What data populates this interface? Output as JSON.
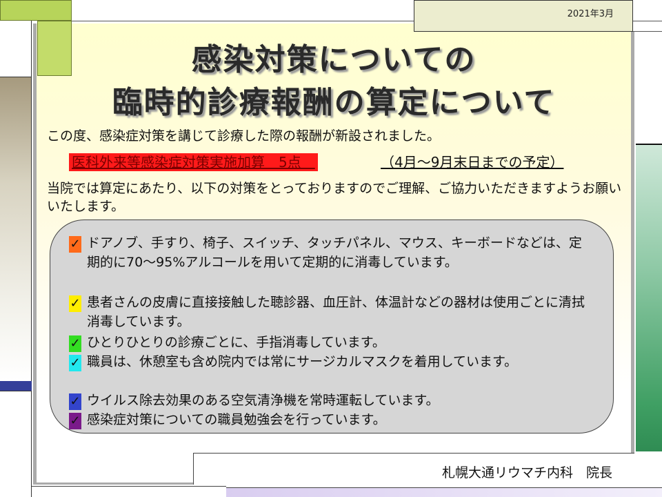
{
  "header": {
    "date": "2021年3月"
  },
  "title": {
    "line1": "感染対策についての",
    "line2": "臨時的診療報酬の算定について"
  },
  "intro": "この度、感染症対策を講じて診療した際の報酬が新設されました。",
  "fee": {
    "name": "医科外来等感染症対策実施加算　5点　",
    "period": "（4月～9月末日までの予定）"
  },
  "explain": "当院では算定にあたり、以下の対策をとっておりますのでご理解、ご協力いただきますようお願いいたします。",
  "check_mark": "✓",
  "measures": [
    {
      "text": "ドアノブ、手すり、椅子、スイッチ、タッチパネル、マウス、キーボードなどは、定期的に70～95%アルコールを用いて定期的に消毒しています。",
      "color": "#ff6a1a"
    },
    {
      "text": "患者さんの皮膚に直接接触した聴診器、血圧計、体温計などの器材は使用ごとに清拭消毒しています。",
      "color": "#ffee00"
    },
    {
      "text": "ひとりひとりの診療ごとに、手指消毒しています。",
      "color": "#33dd22"
    },
    {
      "text": "職員は、休憩室も含め院内では常にサージカルマスクを着用しています。",
      "color": "#22e8ee"
    },
    {
      "text": "ウイルス除去効果のある空気清浄機を常時運転しています。",
      "color": "#3344cc"
    },
    {
      "text": "感染症対策についての職員勉強会を行っています。",
      "color": "#7a1a8a"
    }
  ],
  "footer": {
    "signature": "札幌大通リウマチ内科　院長"
  }
}
